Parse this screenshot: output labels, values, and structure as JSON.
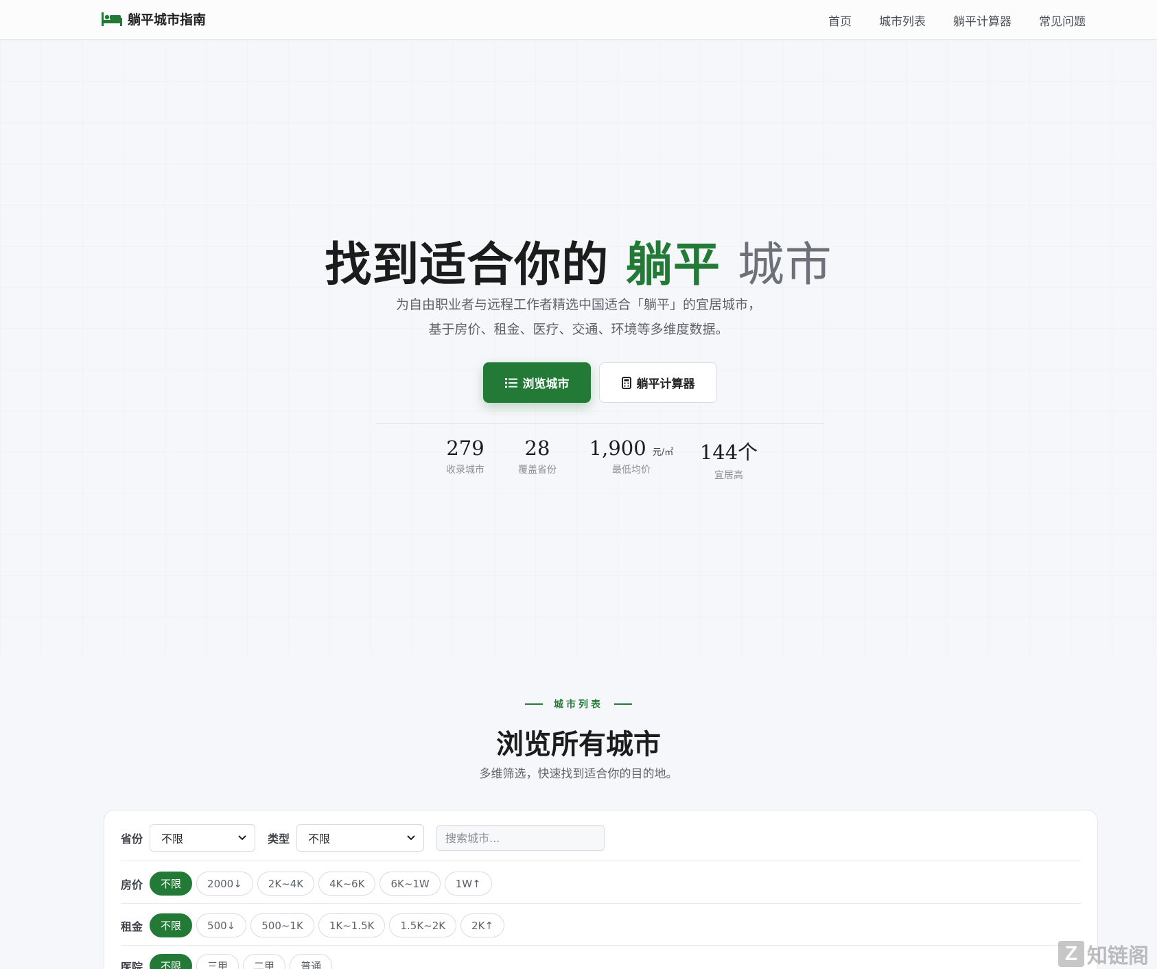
{
  "brand": {
    "name": "躺平城市指南",
    "icon": "bed-icon",
    "color": "#237a36"
  },
  "nav": {
    "links": [
      "首页",
      "城市列表",
      "躺平计算器",
      "常见问题"
    ]
  },
  "hero": {
    "title_part1": "找到适合你的",
    "title_accent": "躺平",
    "title_part2": "城市",
    "subtitle_line1": "为自由职业者与远程工作者精选中国适合「躺平」的宜居城市，",
    "subtitle_line2": "基于房价、租金、医疗、交通、环境等多维度数据。",
    "primary_button": {
      "label": "浏览城市",
      "icon": "list-icon"
    },
    "secondary_button": {
      "label": "躺平计算器",
      "icon": "calculator-icon"
    }
  },
  "stats": [
    {
      "value": "279",
      "unit": "",
      "label": "收录城市"
    },
    {
      "value": "28",
      "unit": "",
      "label": "覆盖省份"
    },
    {
      "value": "1,900",
      "unit": "元/㎡",
      "label": "最低均价"
    },
    {
      "value": "144个",
      "unit": "",
      "label": "宜居高"
    }
  ],
  "section": {
    "eyebrow": "城市列表",
    "title": "浏览所有城市",
    "subtitle": "多维筛选，快速找到适合你的目的地。"
  },
  "filters": {
    "province_label": "省份",
    "province_value": "不限",
    "type_label": "类型",
    "type_value": "不限",
    "search_placeholder": "搜索城市...",
    "price": {
      "label": "房价",
      "options": [
        "不限",
        "2000↓",
        "2K~4K",
        "4K~6K",
        "6K~1W",
        "1W↑"
      ],
      "selected": "不限"
    },
    "rent": {
      "label": "租金",
      "options": [
        "不限",
        "500↓",
        "500~1K",
        "1K~1.5K",
        "1.5K~2K",
        "2K↑"
      ],
      "selected": "不限"
    },
    "medical": {
      "label": "医院",
      "options": [
        "不限",
        "三甲",
        "二甲",
        "普通"
      ],
      "selected": "不限"
    }
  },
  "watermark": {
    "letter": "Z",
    "text": "知链阁"
  },
  "colors": {
    "accent": "#237a36",
    "text": "#1c1c1c",
    "muted": "#5d626a",
    "background": "#f6f7fa"
  }
}
